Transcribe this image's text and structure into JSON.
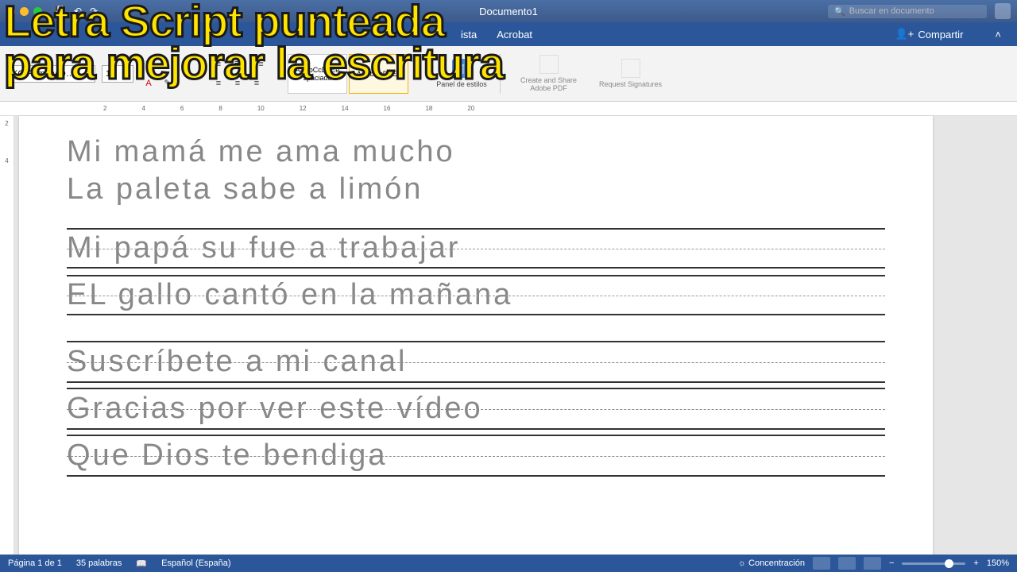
{
  "overlay": {
    "line1": "Letra Script punteada",
    "line2": "para mejorar la escritura"
  },
  "titlebar": {
    "doc": "Documento1",
    "search_placeholder": "Buscar en documento"
  },
  "tabs": {
    "vista": "ista",
    "acrobat": "Acrobat",
    "compartir": "Compartir"
  },
  "ribbon": {
    "font": "KG Primary D…",
    "size": "14",
    "style_sample": "AaBbCcDdEe",
    "style_label": "spaciado",
    "panel_estilos": "Panel de estilos",
    "create_pdf": "Create and Share Adobe PDF",
    "request_sig": "Request Signatures"
  },
  "ruler_h": [
    "2",
    "4",
    "6",
    "8",
    "10",
    "12",
    "14",
    "16",
    "18",
    "20"
  ],
  "ruler_v": [
    "2",
    "4"
  ],
  "doc_lines": {
    "l1": "Mi mamá me ama mucho",
    "l2": "La paleta sabe a limón",
    "l3": "Mi papá su fue a trabajar",
    "l4": "EL gallo cantó en la mañana",
    "l5": "Suscríbete a mi canal",
    "l6": "Gracias por ver este vídeo",
    "l7": "Que Dios te bendiga"
  },
  "status": {
    "page": "Página 1 de 1",
    "words": "35 palabras",
    "lang": "Español (España)",
    "focus": "Concentración",
    "zoom": "150%"
  }
}
